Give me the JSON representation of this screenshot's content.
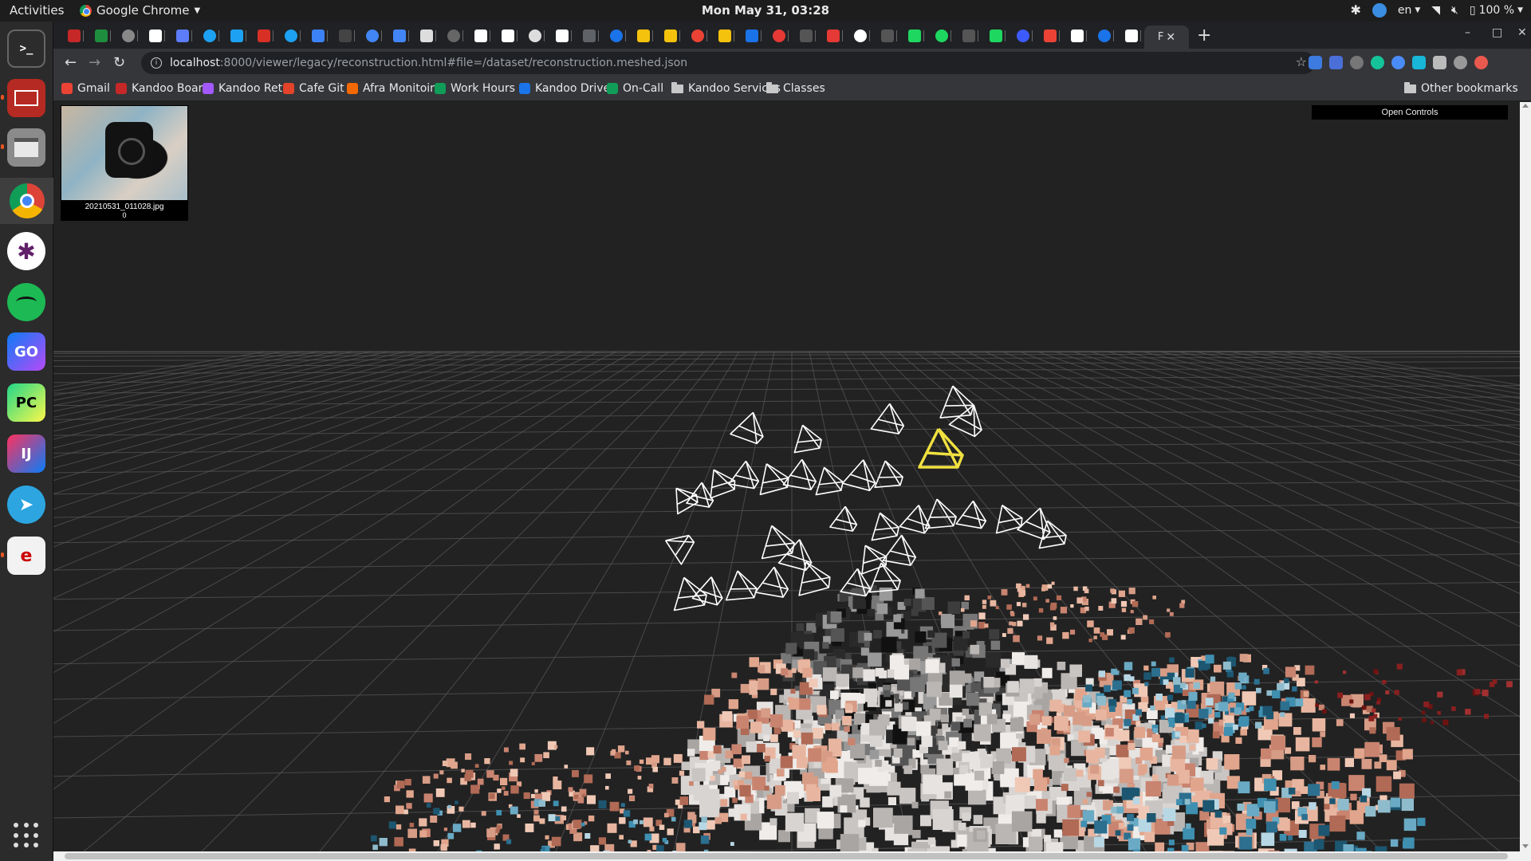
{
  "topbar": {
    "activities": "Activities",
    "app_name": "Google Chrome",
    "clock": "Mon May 31, 03:28",
    "language": "en",
    "battery": "100 %"
  },
  "dock": {
    "items": [
      "terminal-icon",
      "screenshot-tool-icon",
      "file-manager-icon",
      "chrome-icon",
      "slack-icon",
      "spotify-icon",
      "goland-icon",
      "pycharm-icon",
      "intellij-icon",
      "telegram-icon",
      "document-viewer-icon"
    ]
  },
  "browser": {
    "url_host": "localhost",
    "url_path": ":8000/viewer/legacy/reconstruction.html#file=/dataset/reconstruction.meshed.json",
    "bookmarks": [
      "Gmail",
      "Kandoo Board",
      "Kandoo Retro",
      "Cafe Git",
      "Afra Monitoing",
      "Work Hours",
      "Kandoo Drive",
      "On-Call",
      "Kandoo Services",
      "Classes"
    ],
    "other_bookmarks": "Other bookmarks",
    "active_tab_letter": "F"
  },
  "viewer": {
    "image_name": "20210531_011028.jpg",
    "image_index": "0",
    "controls_label": "Open Controls"
  },
  "colors": {
    "background": "#222222",
    "grid": "#5a5a5a",
    "camera_frustum": "#ffffff",
    "selected_camera": "#f0e040"
  }
}
